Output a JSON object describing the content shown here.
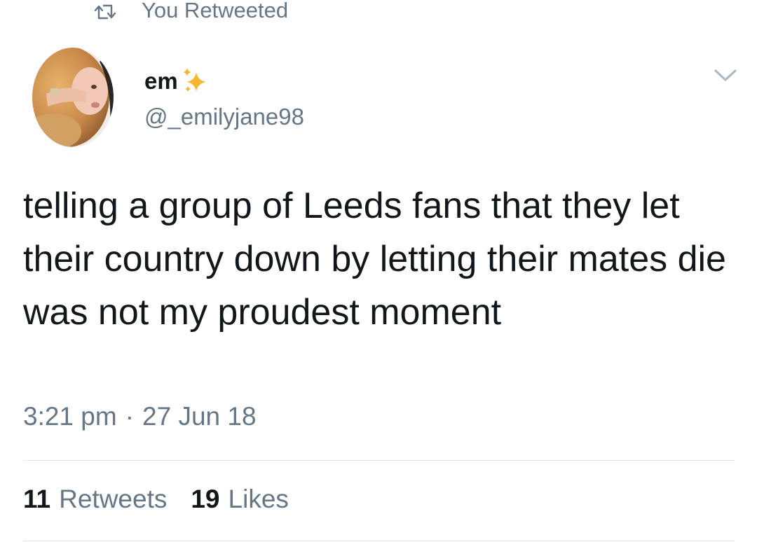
{
  "retweet_banner": {
    "icon": "retweet-icon",
    "text": "You Retweeted"
  },
  "author": {
    "display_name": "em",
    "name_emoji": "sparkles-icon",
    "handle": "@_emilyjane98",
    "avatar": "avatar-photo"
  },
  "menu": {
    "icon": "chevron-down-icon"
  },
  "tweet": {
    "text": "telling a group of Leeds fans that they let their country down by letting their mates die was not my proudest moment",
    "time": "3:21 pm",
    "separator": "·",
    "date": "27 Jun 18"
  },
  "stats": {
    "retweets_count": "11",
    "retweets_label": "Retweets",
    "likes_count": "19",
    "likes_label": "Likes"
  },
  "colors": {
    "primary_text": "#14171a",
    "secondary_text": "#657786",
    "divider": "#e1e8ed",
    "sparkle": "#f5b731"
  }
}
